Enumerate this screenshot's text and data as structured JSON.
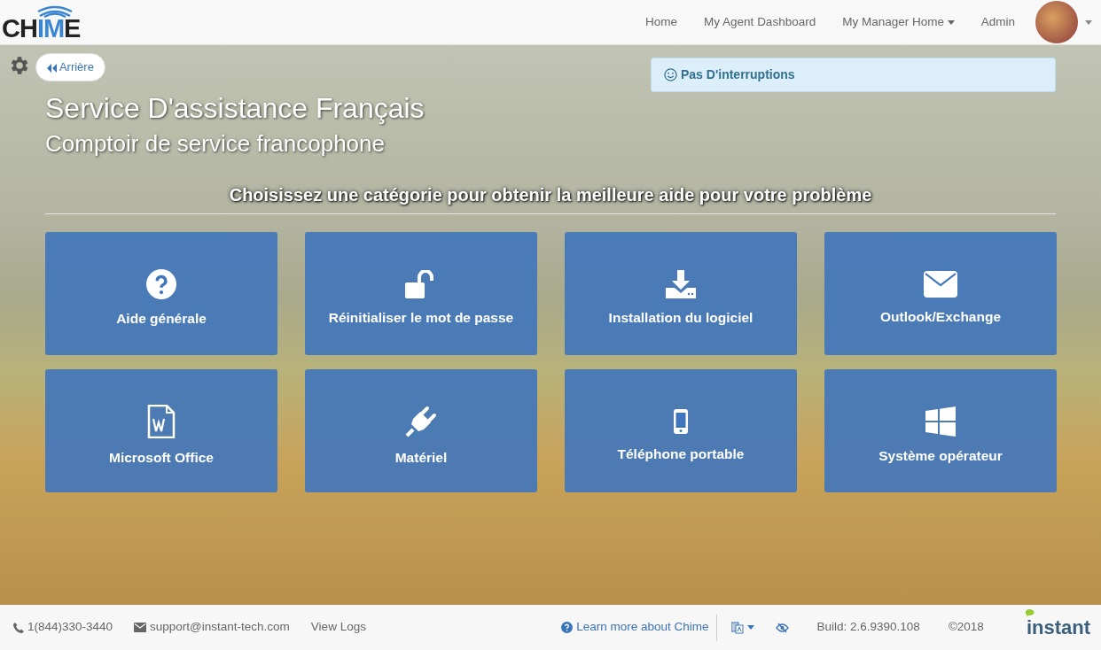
{
  "navbar": {
    "logo": "CHIME",
    "links": [
      {
        "label": "Home",
        "dropdown": false
      },
      {
        "label": "My Agent Dashboard",
        "dropdown": false
      },
      {
        "label": "My Manager Home",
        "dropdown": true
      },
      {
        "label": "Admin",
        "dropdown": false
      }
    ]
  },
  "back_button": "Arrière",
  "status_alert": "Pas D'interruptions",
  "title": "Service D'assistance Français",
  "subtitle": "Comptoir de service francophone",
  "prompt": "Choisissez une catégorie pour obtenir la meilleure aide pour votre problème",
  "categories": [
    {
      "label": "Aide générale",
      "kind": "help"
    },
    {
      "label": "Réinitialiser le mot de passe",
      "kind": "password"
    },
    {
      "label": "Installation du logiciel",
      "kind": "software"
    },
    {
      "label": "Outlook/Exchange",
      "kind": "email"
    },
    {
      "label": "Microsoft Office",
      "kind": "office"
    },
    {
      "label": "Matériel",
      "kind": "hardware"
    },
    {
      "label": "Téléphone portable",
      "kind": "mobile"
    },
    {
      "label": "Système opérateur",
      "kind": "os"
    }
  ],
  "footer": {
    "phone": "1(844)330-3440",
    "email": "support@instant-tech.com",
    "view_logs": "View Logs",
    "learn_more": "Learn more about Chime",
    "build": "Build: 2.6.9390.108",
    "copyright": "©2018",
    "brand": "instant"
  }
}
